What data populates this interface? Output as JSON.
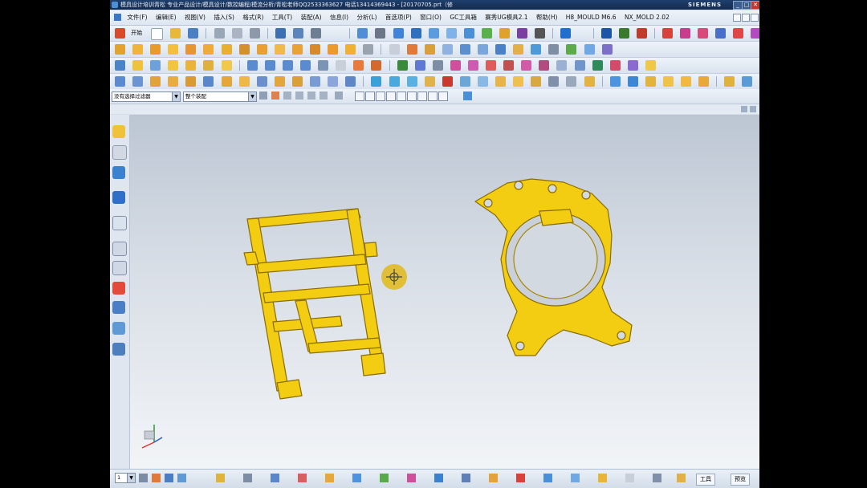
{
  "title_bar": {
    "title": "模具设计培训青松 专业产品设计/模具设计/数控编程/模流分析/青松老师QQ2533363627 电话13414369443 - [20170705.prt（修",
    "brand": "SIEMENS",
    "controls": [
      "_",
      "□",
      "✕"
    ]
  },
  "menu_bar": {
    "items": [
      "文件(F)",
      "编辑(E)",
      "视图(V)",
      "插入(S)",
      "格式(R)",
      "工具(T)",
      "装配(A)",
      "信息(I)",
      "分析(L)",
      "首选项(P)",
      "窗口(O)",
      "GC工具箱",
      "赛秀UG模具2.1",
      "帮助(H)",
      "H8_MOULD M6.6",
      "NX_MOLD 2.02"
    ]
  },
  "standard_toolbar": {
    "start_label": "开始"
  },
  "filter_bar": {
    "selection_filter": "没有选择过滤器",
    "assembly_scope": "整个装配"
  },
  "bottom_bar": {
    "layer_value": "1",
    "tools_button": "工具",
    "preview_button": "预览"
  },
  "colors": {
    "part_yellow": "#f2cd12",
    "part_edge": "#8a6c00",
    "title_bg": "#1f3f6d",
    "cursor": "#e2b81a"
  }
}
